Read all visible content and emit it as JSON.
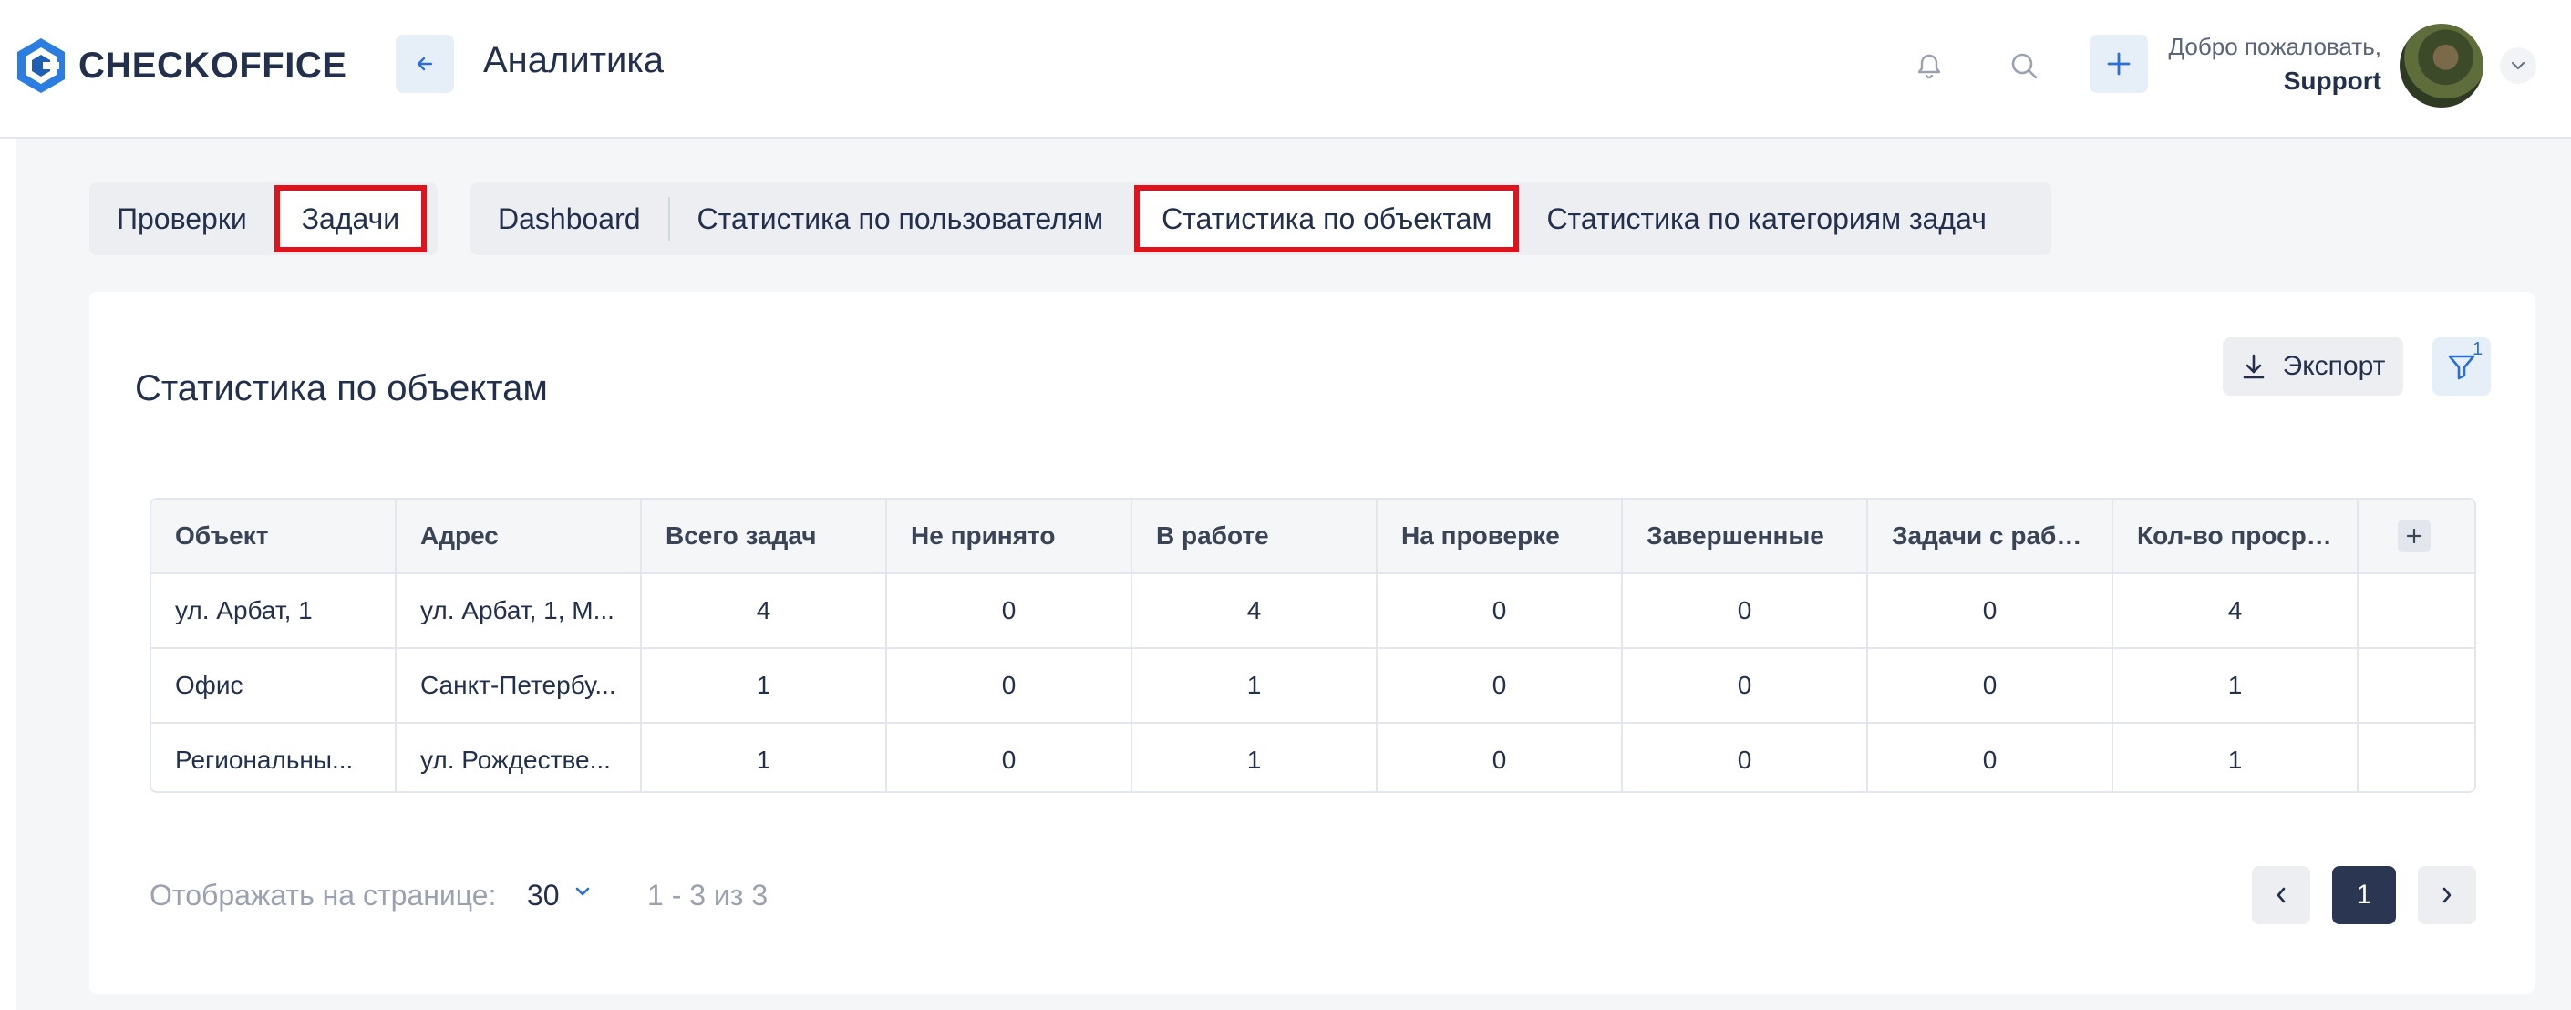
{
  "app": {
    "brand": "CHECKOFFICE",
    "page_title": "Аналитика"
  },
  "user": {
    "greeting": "Добро пожаловать,",
    "name": "Support"
  },
  "section_tabs": [
    "Проверки",
    "Задачи"
  ],
  "view_tabs": [
    "Dashboard",
    "Статистика по пользователям",
    "Статистика по объектам",
    "Статистика по категориям задач"
  ],
  "card": {
    "title": "Статистика по объектам",
    "export_label": "Экспорт",
    "filter_count": "1"
  },
  "table": {
    "columns": [
      "Объект",
      "Адрес",
      "Всего задач",
      "Не принято",
      "В работе",
      "На проверке",
      "Завершенные",
      "Задачи с рабо...",
      "Кол-во просро..."
    ],
    "rows": [
      [
        "ул. Арбат, 1",
        "ул. Арбат, 1, М...",
        "4",
        "0",
        "4",
        "0",
        "0",
        "0",
        "4"
      ],
      [
        "Офис",
        "Санкт-Петербу...",
        "1",
        "0",
        "1",
        "0",
        "0",
        "0",
        "1"
      ],
      [
        "Региональны...",
        "ул. Рождестве...",
        "1",
        "0",
        "1",
        "0",
        "0",
        "0",
        "1"
      ]
    ]
  },
  "pagination": {
    "per_page_label": "Отображать на странице:",
    "per_page": "30",
    "range": "1 - 3 из 3",
    "current_page": "1"
  },
  "colors": {
    "accent": "#2b6fd6",
    "highlight_border": "#e0121b",
    "dark": "#2a3652"
  }
}
